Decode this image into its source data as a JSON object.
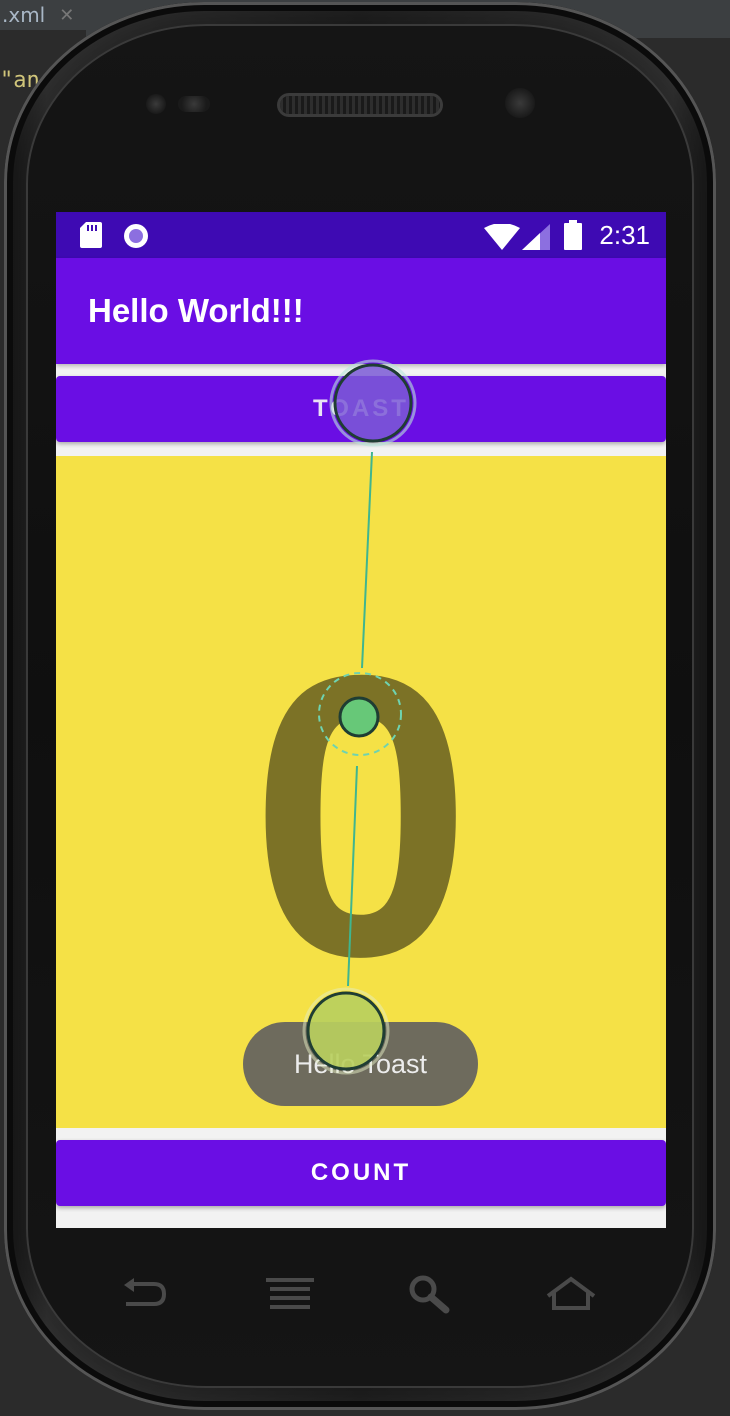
{
  "ide": {
    "tab_label": ".xml",
    "code_fragment": "\"an"
  },
  "status_bar": {
    "time": "2:31",
    "icons": [
      "sd-card-icon",
      "record-icon",
      "wifi-icon",
      "signal-icon",
      "battery-icon"
    ]
  },
  "app_bar": {
    "title": "Hello World!!!"
  },
  "buttons": {
    "toast_label": "TOAST",
    "count_label": "COUNT"
  },
  "counter": {
    "value": "0"
  },
  "toast_message": "Hello Toast",
  "nav_bar": {
    "icons": [
      "back-icon",
      "menu-icon",
      "search-icon",
      "home-icon"
    ]
  },
  "colors": {
    "status_bar": "#3e0ab3",
    "primary": "#6a0ee4",
    "count_background": "#f5e146",
    "count_text": "#7c7226",
    "gesture_line": "#3fb58f"
  }
}
